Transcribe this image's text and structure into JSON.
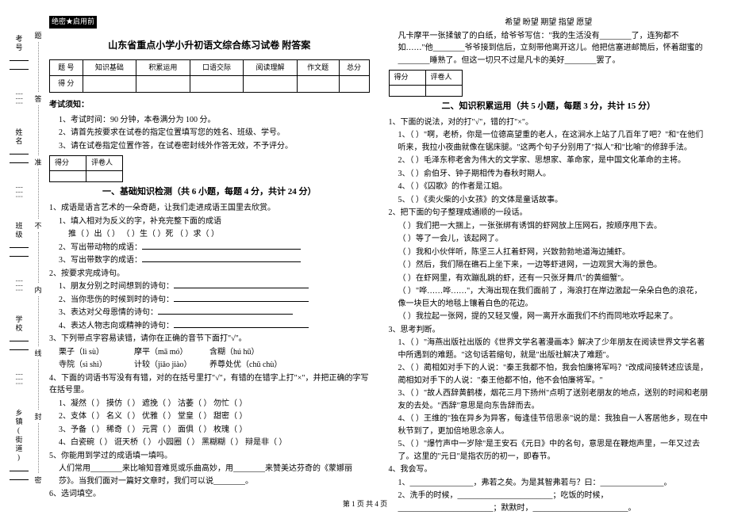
{
  "sidebar": {
    "labels": [
      "考号",
      "姓名",
      "班级",
      "学校",
      "乡镇(街道)"
    ],
    "inner": [
      "题",
      "答",
      "准",
      "不",
      "内",
      "线",
      "封",
      "密"
    ]
  },
  "confidential": "绝密★启用前",
  "title": "山东省重点小学小升初语文综合练习试卷 附答案",
  "score_table": {
    "headers": [
      "题 号",
      "知识基础",
      "积累运用",
      "口语交际",
      "阅读理解",
      "作文题",
      "总分"
    ],
    "row_label": "得 分"
  },
  "exam_notice": {
    "heading": "考试须知：",
    "items": [
      "1、考试时间：90 分钟，本卷满分为 100 分。",
      "2、请首先按要求在试卷的指定位置填写您的姓名、班级、学号。",
      "3、请在试卷指定位置作答，在试卷密封线外作答无效，不予评分。"
    ]
  },
  "mini_table": {
    "c1": "得分",
    "c2": "评卷人"
  },
  "section1": {
    "title": "一、基础知识检测（共 6 小题，每题 4 分，共计 24 分）",
    "q1_lead": "1、成语是语言艺术的一朵奇葩，让我们走进成语王国里去欣赏。",
    "q1_1": "1、填入相对为反义的字，补充完整下面的成语",
    "q1_1_line": "推（ ）出（ ）   （ ）生（ ）死   （ ）求（ ）",
    "q1_2": "2、写出带动物的成语：",
    "q1_3": "3、写出带数字的成语：",
    "q2_lead": "2、按要求完成诗句。",
    "q2_items": [
      "1、朋友分别之时间想到的诗句：",
      "2、当你悲伤的时候到时的诗句：",
      "3、表达对父母恩情的诗句：",
      "4、表达人物志向或精神的诗句："
    ],
    "q3_lead": "3、下列带点字容易读错，请你在正确的音节下面打\"√\"。",
    "q3_row1": [
      "栗子（lì  sù）",
      "摩平（mā  mó）",
      "含糊（hú  hū）"
    ],
    "q3_row2": [
      "寺院（sì  shì）",
      "计较（jiǎo  jiào）",
      "养尊处优（chǔ  chù）"
    ],
    "q4_lead": "4、下面的词语书写没有有错，对的在括号里打\"√\"，有错的在错字上打\"×\"，并把正确的字写在括号里。",
    "q4_rows": [
      "1、凝然（    ）   摸仿（    ）   遮挽（    ）   沽萎（    ）   勿忙（    ）",
      "2、支体（    ）   名义（    ）   优雅（    ）   堂皇（    ）   甜密（    ）",
      "3、予备（    ）   稀奇（    ）   元霄（    ）   面俱（    ）   枚瑰（    ）",
      "4、白瓷碗（    ）   诳天桥（    ）   小园圈（    ）   黑糊糊（    ）   辩是非（    ）"
    ],
    "q5_lead": "5、你能用到学过的成语填一填吗。",
    "q5_body": "人们常用________来比喻知音难觅或乐曲高妙，用________来赞美达芬奇的《蒙娜丽莎》。当我们面对一篇好文章时，我们可以说________。",
    "q6": "6、选词填空。"
  },
  "right_top": {
    "words": "希望     盼望     期望     指望     愿望",
    "passage": [
      "凡卡摩平一张揉皱了的白纸，给爷爷写信：\"我的生活没有________了，连狗都不如……\"他________爷爷接到信后，立刻带他离开这儿。他把信塞进邮筒后，怀着甜蜜的________睡熟了。但这一切只不过是凡卡的美好________罢了。"
    ]
  },
  "section2": {
    "title": "二、知识积累运用（共 5 小题，每题 3 分，共计 15 分）",
    "q1_lead": "1、下面的说法，对的打\"√\"，错的打\"×\"。",
    "q1_items": [
      "1、（    ）\"啊，老桥，你是一位德高望重的老人，在这涧水上站了几百年了吧？\"和\"在他们听来，我拉小夜曲就像在锯床腿。\"这两个句子分别用了\"拟人\"和\"比喻\"的修辞手法。",
      "2、（    ）毛泽东称老舍为伟大的文学家、思想家、革命家，是中国文化革命的主将。",
      "3、（    ）俞伯牙、钟子期相传为春秋时期人。",
      "4、（    ）《囚歌》的作者是江姐。",
      "5、（    ）《卖火柴的小女孩》的文体是童话故事。"
    ],
    "q2_lead": "2、把下面的句子整理成通顺的一段话。",
    "q2_items": [
      "（    ）我们把一大捆上，一张张绑有诱饵的虾网放上压网石，按顺序甩下去。",
      "（    ）等了一会儿，该起网了。",
      "（    ）我和小伙伴听，陈坚三人扛着虾网，兴致勃勃地道海边捕虾。",
      "（    ）然后，我们隔在礁石上坐下来，一边等虾进网，一边观赏大海的景色。",
      "（    ）在虾网里，有欢蹦乱跳的虾，还有一只张牙舞爪\"的黄细蟹\"。",
      "（    ）\"哗……哗……\"，大海出现在我们面前了 ，海浪打在岸边激起一朵朵白色的浪花，像一块巨大的地毯上镶着白色的花边。",
      "（    ）我拉起一张网，提的又轻叉慢，网一离开水面我们不约而同地欢呼起来了。"
    ],
    "q3_lead": "3、思考判断。",
    "q3_items": [
      "1、（    ）\"海燕出版社出版的《世界文学名著漫画本》解决了少年朋友在阅读世界文学名著中所遇到的难题。\"这句话若缩句，就是\"出版社解决了难题\"。",
      "2、（    ）蔺相如对手下的人说：\"秦王我都不怕，我会怕廉将军吗？\"改成间接转述应该是，蔺相如对手下的人说：\"秦王他都不怕，他不会怕廉将军。\"",
      "3、（    ）\"故人西辞黄鹤楼，烟花三月下扬州\"点明了送别老朋友的地点，送别的时间和老朋友的去处。\"西辞\"意思是向东告辞而去。",
      "4、（    ）王维的\"独在异乡为异客，每逢佳节倍思亲\"说的是：我独自一人客居他乡，现在中秋节到了，更加倍地思念亲人。",
      "5、（    ）\"爆竹声中一岁除\"是王安石《元日》中的名句，意思是在鞭炮声里，一年又过去了。这里的\"元日\"是指农历的初一，即春节。"
    ],
    "q4": "4、我会写。",
    "q4_items": [
      "1、________________，弗若之矣。为是其智弗若与？曰：________________。",
      "2、洗手的时候，________________________；吃饭的时候，________________________；默默时，________________________。"
    ]
  },
  "footer": "第 1 页 共 4 页"
}
